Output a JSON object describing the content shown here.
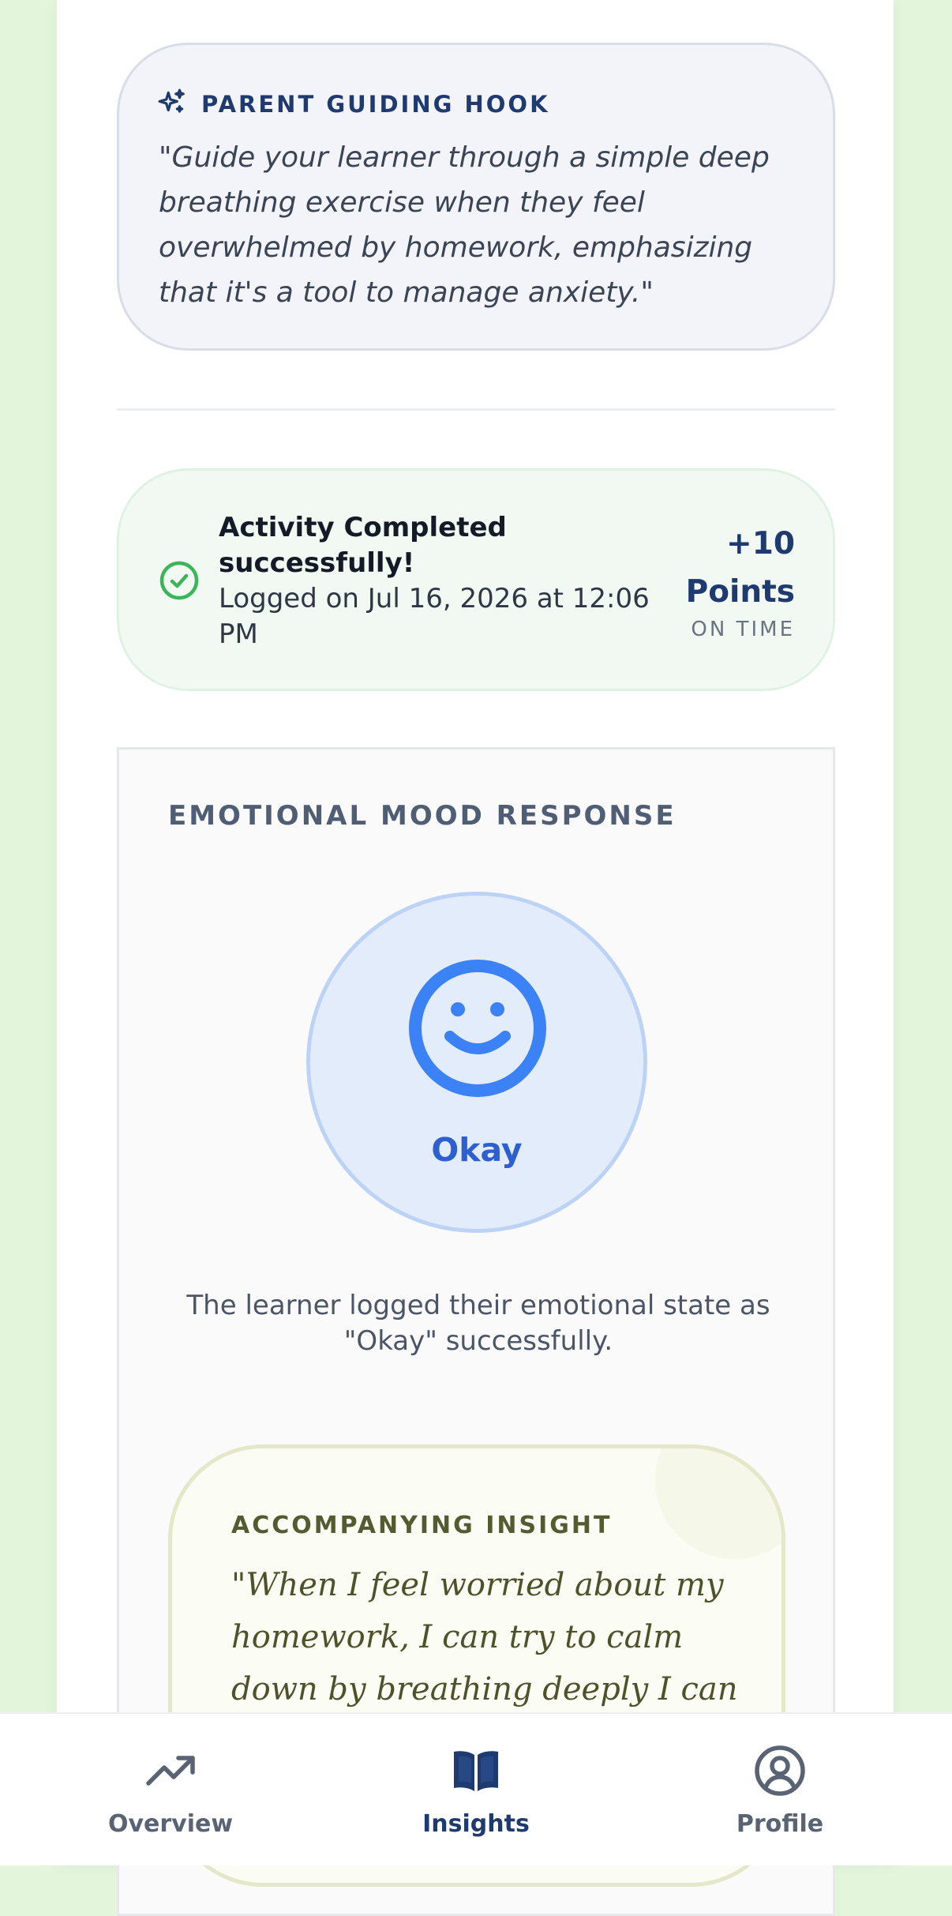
{
  "hook": {
    "icon": "sparkles-icon",
    "title": "PARENT GUIDING HOOK",
    "text": "\"Guide your learner through a simple deep breathing exercise when they feel overwhelmed by homework, emphasizing that it's a tool to manage anxiety.\""
  },
  "activity": {
    "icon": "check-circle-icon",
    "title": "Activity Completed successfully!",
    "logged": "Logged on Jul 16, 2026 at 12:06 PM",
    "points_value": "+10",
    "points_label": "Points",
    "timing": "ON TIME"
  },
  "mood": {
    "section_title": "EMOTIONAL MOOD RESPONSE",
    "icon": "smile-face-icon",
    "label": "Okay",
    "description": "The learner logged their emotional state as \"Okay\" successfully."
  },
  "insight": {
    "title": "ACCOMPANYING INSIGHT",
    "text": "\"When I feel worried about my homework, I can try to calm down by breathing deeply I can do that"
  },
  "nav": {
    "items": [
      {
        "label": "Overview",
        "icon": "trending-up-icon",
        "active": false
      },
      {
        "label": "Insights",
        "icon": "open-book-icon",
        "active": true
      },
      {
        "label": "Profile",
        "icon": "user-circle-icon",
        "active": false
      }
    ]
  },
  "colors": {
    "background": "#e3f6dc",
    "primary": "#1e3a6e",
    "success": "#3cb55a",
    "mood_blue": "#3b82f6",
    "insight_text": "#4d522a"
  }
}
